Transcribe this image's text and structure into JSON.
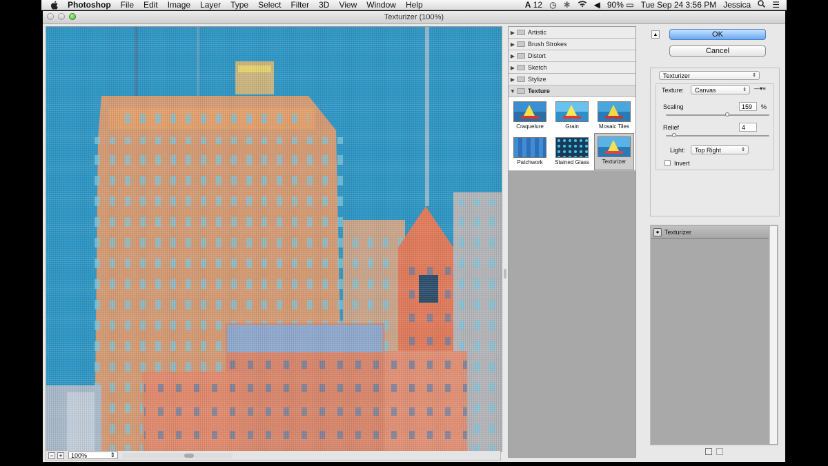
{
  "menubar": {
    "apple_icon": "apple-icon",
    "app_name": "Photoshop",
    "menus": [
      "File",
      "Edit",
      "Image",
      "Layer",
      "Type",
      "Select",
      "Filter",
      "3D",
      "View",
      "Window",
      "Help"
    ],
    "status": {
      "adobe_count": "12",
      "battery": "90%",
      "datetime": "Tue Sep 24  3:56 PM",
      "user": "Jessica"
    }
  },
  "window": {
    "title": "Texturizer (100%)"
  },
  "preview": {
    "zoom": "100%",
    "zoom_out": "−",
    "zoom_in": "+"
  },
  "gallery": {
    "categories": [
      "Artistic",
      "Brush Strokes",
      "Distort",
      "Sketch",
      "Stylize",
      "Texture"
    ],
    "open_category": "Texture",
    "thumbnails": [
      "Craquelure",
      "Grain",
      "Mosaic Tiles",
      "Patchwork",
      "Stained Glass",
      "Texturizer"
    ],
    "selected": "Texturizer"
  },
  "buttons": {
    "ok": "OK",
    "cancel": "Cancel",
    "collapse": "▲"
  },
  "settings": {
    "filter": "Texturizer",
    "texture_label": "Texture:",
    "texture_value": "Canvas",
    "scaling_label": "Scaling",
    "scaling_value": "159",
    "scaling_unit": "%",
    "scaling_level": 0.59,
    "relief_label": "Relief",
    "relief_value": "4",
    "relief_level": 0.08,
    "light_label": "Light:",
    "light_value": "Top Right",
    "invert_label": "Invert"
  },
  "layers": {
    "items": [
      "Texturizer"
    ]
  }
}
